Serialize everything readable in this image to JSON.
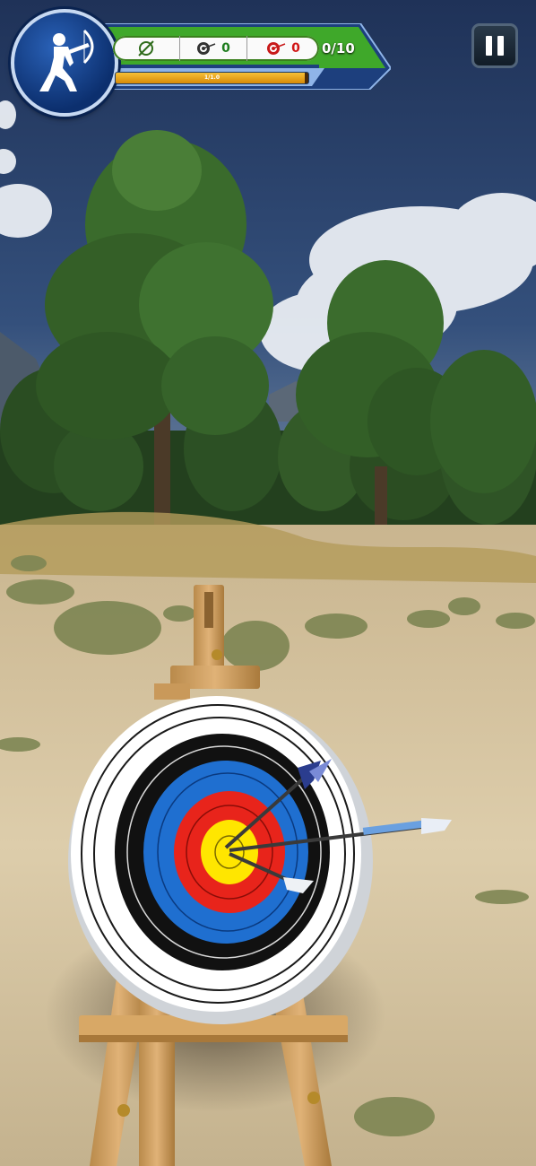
{
  "hud": {
    "hit_count": "0",
    "miss_count": "0",
    "arrows_label": "0/10",
    "power_label": "1/1.0",
    "power_level": 0.98
  },
  "icons": {
    "player": "archer-icon",
    "current": "bow-target-icon",
    "hit": "bullseye-hit-icon",
    "miss": "target-miss-icon",
    "pause": "pause-icon"
  },
  "colors": {
    "sky": "#28406e",
    "hud_green": "#3fa82a",
    "hud_blue": "#1d3f7d",
    "target_gold": "#ffe600",
    "target_red": "#e8241b",
    "target_blue": "#1f6fd0"
  }
}
